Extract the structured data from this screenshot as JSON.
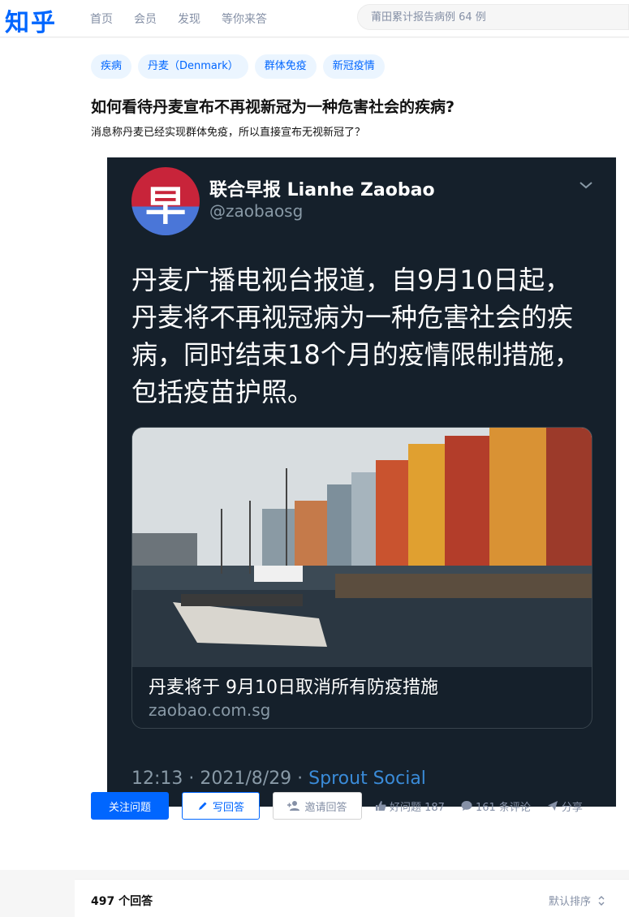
{
  "header": {
    "logo": "知乎",
    "nav": [
      "首页",
      "会员",
      "发现",
      "等你来答"
    ],
    "search_placeholder": "莆田累计报告病例 64 例"
  },
  "question": {
    "tags": [
      "疾病",
      "丹麦（Denmark）",
      "群体免疫",
      "新冠疫情"
    ],
    "title": "如何看待丹麦宣布不再视新冠为一种危害社会的疾病?",
    "description": "消息称丹麦已经实现群体免疫，所以直接宣布无视新冠了？"
  },
  "tweet": {
    "avatar_char": "早",
    "account_name": "联合早报 Lianhe Zaobao",
    "handle": "@zaobaosg",
    "text": "丹麦广播电视台报道，自9月10日起，丹麦将不再视冠病为一种危害社会的疾病，同时结束18个月的疫情限制措施，包括疫苗护照。",
    "link_title": "丹麦将于 9月10日取消所有防疫措施",
    "link_domain": "zaobao.com.sg",
    "time": "12:13 · 2021/8/29 · ",
    "source": "Sprout Social"
  },
  "actions": {
    "follow": "关注问题",
    "write": "写回答",
    "invite": "邀请回答",
    "good_question": "好问题 187",
    "comments": "161 条评论",
    "share": "分享"
  },
  "answers": {
    "count": "497 个回答",
    "sort": "默认排序"
  },
  "colors": {
    "brand": "#0066ff",
    "tag_bg": "#ebf5ff",
    "tweet_bg": "#15202b",
    "muted": "#8590a6"
  }
}
